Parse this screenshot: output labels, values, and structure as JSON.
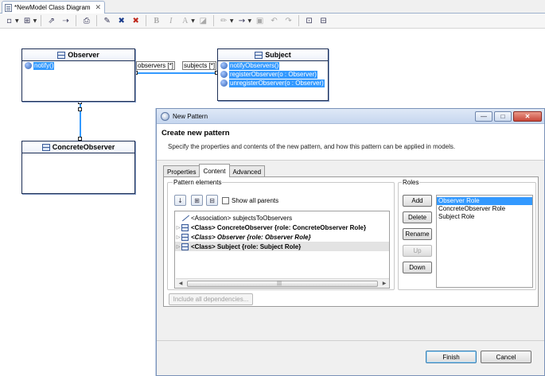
{
  "editor": {
    "tab_title": "*NewModel Class Diagram",
    "tab_close": "✕"
  },
  "toolbar": {
    "buttons": [
      {
        "icon": "select-icon",
        "glyph": "▫"
      },
      {
        "icon": "arrange-icon",
        "glyph": "⊞"
      },
      {
        "icon": "export-icon",
        "glyph": "⇗"
      },
      {
        "icon": "navigate-icon",
        "glyph": "⇢"
      },
      {
        "icon": "print-icon",
        "glyph": "⎙"
      },
      {
        "icon": "pin-icon",
        "glyph": "✎"
      },
      {
        "icon": "delete-icon",
        "glyph": "✖"
      },
      {
        "icon": "delete-model-icon",
        "glyph": "✖"
      },
      {
        "icon": "bold-icon",
        "glyph": "B"
      },
      {
        "icon": "italic-icon",
        "glyph": "I"
      },
      {
        "icon": "font-color-icon",
        "glyph": "A"
      },
      {
        "icon": "fill-icon",
        "glyph": "◪"
      },
      {
        "icon": "line-color-icon",
        "glyph": "✏"
      },
      {
        "icon": "line-style-icon",
        "glyph": "→"
      },
      {
        "icon": "zoom-icon",
        "glyph": "▣"
      },
      {
        "icon": "undo-icon",
        "glyph": "↶"
      },
      {
        "icon": "redo-icon",
        "glyph": "↷"
      },
      {
        "icon": "snap-icon",
        "glyph": "⊡"
      },
      {
        "icon": "grid-icon",
        "glyph": "⊟"
      }
    ]
  },
  "diagram": {
    "observer": {
      "name": "Observer",
      "ops": [
        "notify()"
      ]
    },
    "subject": {
      "name": "Subject",
      "ops": [
        "notifyObservers()",
        "registerObserver(o : Observer)",
        "unregisterObserver(o : Observer)"
      ]
    },
    "concrete": {
      "name": "ConcreteObserver"
    },
    "role_observers": "observers [*]",
    "role_subjects": "subjects [*]"
  },
  "dialog": {
    "title": "New Pattern",
    "window_buttons": {
      "minimize": "—",
      "maximize": "□",
      "close": "✕"
    },
    "header_title": "Create new pattern",
    "header_desc": "Specify the properties and contents of the new pattern, and how this pattern can be applied in models.",
    "tabs": [
      "Properties",
      "Content",
      "Advanced"
    ],
    "pattern_elements_label": "Pattern elements",
    "show_all_parents": "Show all parents",
    "tree_rows": [
      {
        "text": "<Association> subjectsToObservers",
        "bold": false,
        "italic": false,
        "icon": "association"
      },
      {
        "text": "<Class> ConcreteObserver  {role: ConcreteObserver Role}",
        "bold": true,
        "italic": false,
        "icon": "class"
      },
      {
        "text": "<Class> Observer  {role: Observer Role}",
        "bold": true,
        "italic": true,
        "icon": "class"
      },
      {
        "text": "<Class> Subject  {role: Subject Role}",
        "bold": true,
        "italic": false,
        "icon": "class"
      }
    ],
    "roles_label": "Roles",
    "role_buttons": {
      "add": "Add",
      "delete": "Delete",
      "rename": "Rename",
      "up": "Up",
      "down": "Down"
    },
    "roles": [
      "Observer Role",
      "ConcreteObserver Role",
      "Subject Role"
    ],
    "include_deps": "Include all dependencies...",
    "finish": "Finish",
    "cancel": "Cancel",
    "scroll_grip": "|||"
  },
  "colors": {
    "selection": "#3399ff",
    "diagram_border": "#1c2e55"
  }
}
